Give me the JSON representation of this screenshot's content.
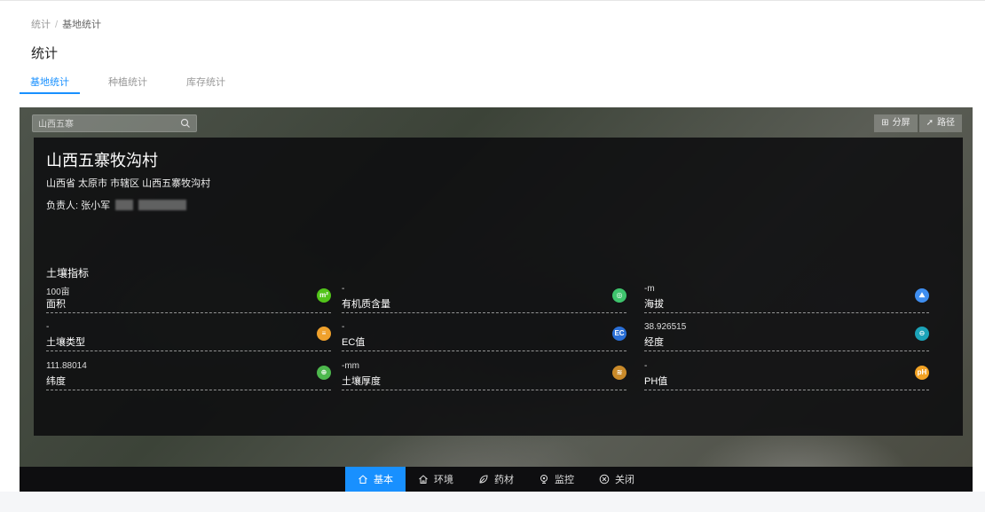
{
  "breadcrumb": {
    "root": "统计",
    "separator": "/",
    "current": "基地统计"
  },
  "page_title": "统计",
  "tabs": [
    {
      "label": "基地统计",
      "active": true
    },
    {
      "label": "种植统计",
      "active": false
    },
    {
      "label": "库存统计",
      "active": false
    }
  ],
  "map": {
    "search_placeholder": "山西五寨",
    "controls": [
      {
        "label": "分屏",
        "icon": "split-icon"
      },
      {
        "label": "路径",
        "icon": "route-icon"
      }
    ]
  },
  "base": {
    "name": "山西五寨牧沟村",
    "address": "山西省 太原市 市辖区 山西五寨牧沟村",
    "manager_label": "负责人: 张小军"
  },
  "soil": {
    "title": "土壤指标",
    "metrics": [
      {
        "value": "100亩",
        "label": "面积",
        "icon": "area-icon",
        "color": "#52c41a",
        "glyph": "m²"
      },
      {
        "value": "-",
        "label": "有机质含量",
        "icon": "organic-icon",
        "color": "#3ec46d",
        "glyph": "◎"
      },
      {
        "value": "-m",
        "label": "海拔",
        "icon": "altitude-icon",
        "color": "#3f8ef0",
        "glyph": "⛰"
      },
      {
        "value": "-",
        "label": "土壤类型",
        "icon": "soil-type-icon",
        "color": "#f0a12c",
        "glyph": "≡"
      },
      {
        "value": "-",
        "label": "EC值",
        "icon": "ec-icon",
        "color": "#2a6fd6",
        "glyph": "EC"
      },
      {
        "value": "38.926515",
        "label": "经度",
        "icon": "longitude-icon",
        "color": "#1ca3b8",
        "glyph": "⊖"
      },
      {
        "value": "111.88014",
        "label": "纬度",
        "icon": "latitude-icon",
        "color": "#4db84d",
        "glyph": "⊕"
      },
      {
        "value": "-mm",
        "label": "土壤厚度",
        "icon": "thickness-icon",
        "color": "#c98a2a",
        "glyph": "≋"
      },
      {
        "value": "-",
        "label": "PH值",
        "icon": "ph-icon",
        "color": "#f2a224",
        "glyph": "pH"
      }
    ]
  },
  "bottom_nav": [
    {
      "label": "基本",
      "icon": "home-icon",
      "active": true
    },
    {
      "label": "环境",
      "icon": "environment-icon",
      "active": false
    },
    {
      "label": "药材",
      "icon": "herb-icon",
      "active": false
    },
    {
      "label": "监控",
      "icon": "monitor-icon",
      "active": false
    },
    {
      "label": "关闭",
      "icon": "close-circle-icon",
      "active": false
    }
  ]
}
